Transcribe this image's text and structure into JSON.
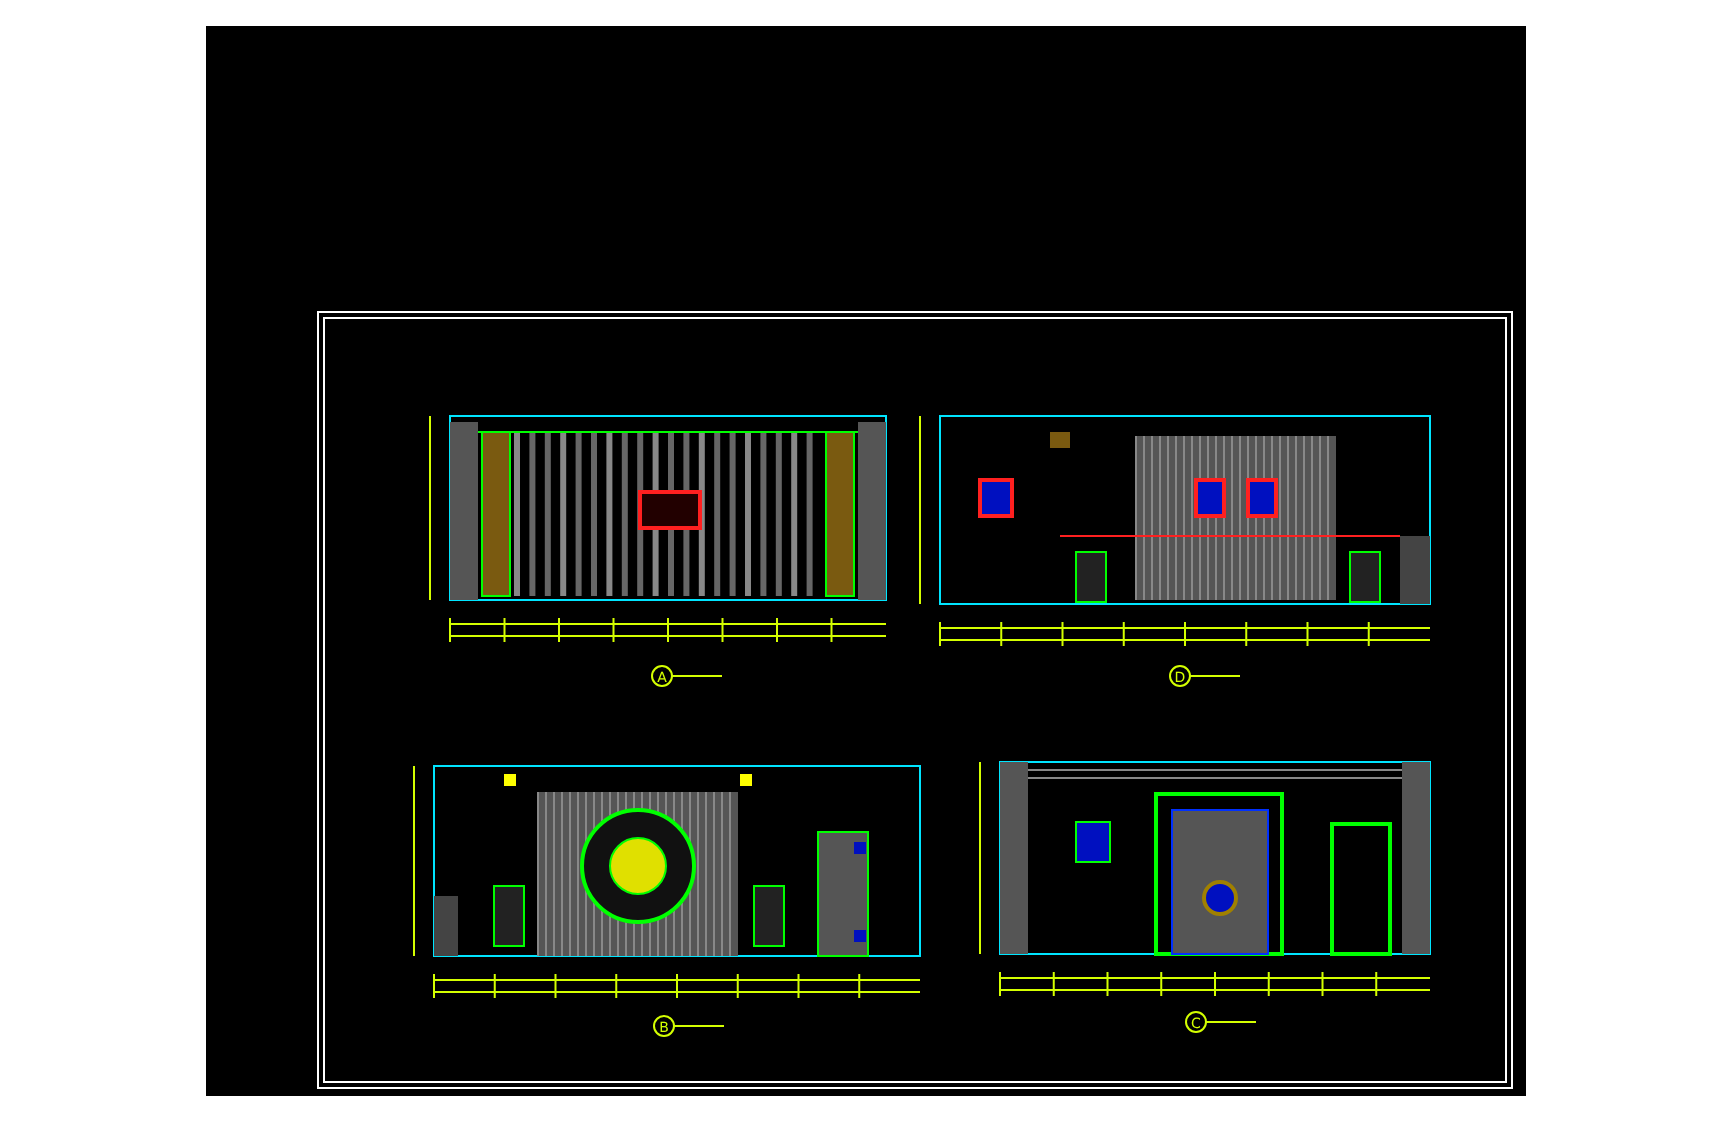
{
  "views": [
    {
      "kind": "window-wall",
      "label": "A"
    },
    {
      "kind": "art-wall",
      "label": "D"
    },
    {
      "kind": "round-feature-wall",
      "label": "B"
    },
    {
      "kind": "door-wall",
      "label": "C"
    }
  ]
}
